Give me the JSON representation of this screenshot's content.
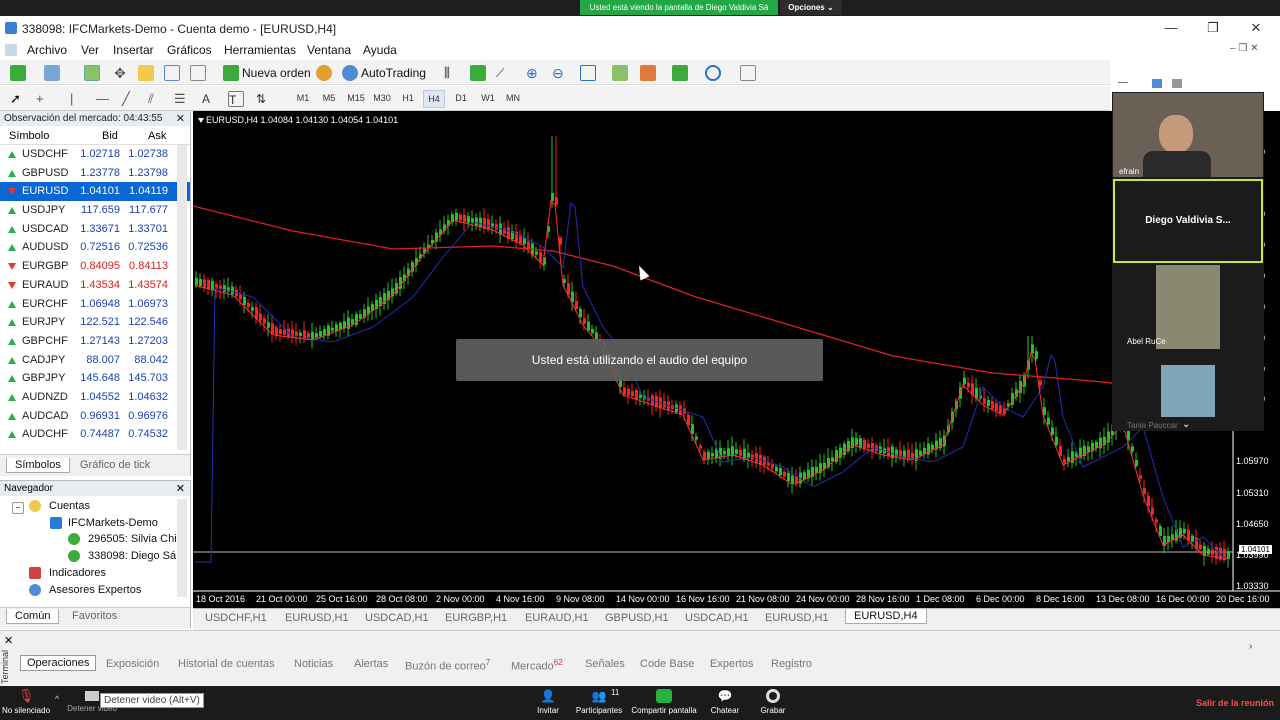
{
  "zoom_top": {
    "sharing_text": "Usted está viendo la pantalla de Diego Valdivia Sá",
    "options_label": "Opciones"
  },
  "window": {
    "title": "338098: IFCMarkets-Demo - Cuenta demo - [EURUSD,H4]"
  },
  "menu": [
    "Archivo",
    "Ver",
    "Insertar",
    "Gráficos",
    "Herramientas",
    "Ventana",
    "Ayuda"
  ],
  "toolbar": {
    "new_order": "Nueva orden",
    "autotrading": "AutoTrading",
    "timeframes": [
      "M1",
      "M5",
      "M15",
      "M30",
      "H1",
      "H4",
      "D1",
      "W1",
      "MN"
    ],
    "active_timeframe": "H4"
  },
  "market_watch": {
    "title": "Observación del mercado: 04:43:55",
    "columns": {
      "symbol": "Símbolo",
      "bid": "Bid",
      "ask": "Ask"
    },
    "rows": [
      {
        "symbol": "USDCHF",
        "bid": "1.02718",
        "ask": "1.02738",
        "dir": "up"
      },
      {
        "symbol": "GBPUSD",
        "bid": "1.23778",
        "ask": "1.23798",
        "dir": "up"
      },
      {
        "symbol": "EURUSD",
        "bid": "1.04101",
        "ask": "1.04119",
        "dir": "down",
        "selected": true
      },
      {
        "symbol": "USDJPY",
        "bid": "117.659",
        "ask": "117.677",
        "dir": "up"
      },
      {
        "symbol": "USDCAD",
        "bid": "1.33671",
        "ask": "1.33701",
        "dir": "up"
      },
      {
        "symbol": "AUDUSD",
        "bid": "0.72516",
        "ask": "0.72536",
        "dir": "up"
      },
      {
        "symbol": "EURGBP",
        "bid": "0.84095",
        "ask": "0.84113",
        "dir": "down",
        "red": true
      },
      {
        "symbol": "EURAUD",
        "bid": "1.43534",
        "ask": "1.43574",
        "dir": "down",
        "red": true
      },
      {
        "symbol": "EURCHF",
        "bid": "1.06948",
        "ask": "1.06973",
        "dir": "up"
      },
      {
        "symbol": "EURJPY",
        "bid": "122.521",
        "ask": "122.546",
        "dir": "up"
      },
      {
        "symbol": "GBPCHF",
        "bid": "1.27143",
        "ask": "1.27203",
        "dir": "up"
      },
      {
        "symbol": "CADJPY",
        "bid": "88.007",
        "ask": "88.042",
        "dir": "up"
      },
      {
        "symbol": "GBPJPY",
        "bid": "145.648",
        "ask": "145.703",
        "dir": "up"
      },
      {
        "symbol": "AUDNZD",
        "bid": "1.04552",
        "ask": "1.04632",
        "dir": "up"
      },
      {
        "symbol": "AUDCAD",
        "bid": "0.96931",
        "ask": "0.96976",
        "dir": "up"
      },
      {
        "symbol": "AUDCHF",
        "bid": "0.74487",
        "ask": "0.74532",
        "dir": "up"
      }
    ],
    "tabs": [
      "Símbolos",
      "Gráfico de tick"
    ]
  },
  "navigator": {
    "title": "Navegador",
    "accounts": "Cuentas",
    "server": "IFCMarkets-Demo",
    "account1": "296505: Silvia Chi",
    "account2": "338098: Diego Sá",
    "indicators": "Indicadores",
    "experts": "Asesores Expertos",
    "tabs": [
      "Común",
      "Favoritos"
    ]
  },
  "chart": {
    "header": "EURUSD,H4  1.04084 1.04130 1.04054 1.04101",
    "price_tag": "1.04101",
    "audio_notice": "Usted está utilizando el audio del equipo",
    "y_ticks": [
      "10",
      "90",
      "80",
      "70",
      "60",
      "50",
      "40",
      "30",
      "1.05970",
      "1.05310",
      "1.04650",
      "1.03990",
      "1.03330"
    ],
    "x_ticks": [
      "18 Oct 2016",
      "21 Oct 00:00",
      "25 Oct 16:00",
      "28 Oct 08:00",
      "2 Nov 00:00",
      "4 Nov 16:00",
      "9 Nov 08:00",
      "14 Nov 00:00",
      "16 Nov 16:00",
      "21 Nov 08:00",
      "24 Nov 00:00",
      "28 Nov 16:00",
      "1 Dec 08:00",
      "6 Dec 00:00",
      "8 Dec 16:00",
      "13 Dec 08:00",
      "16 Dec 00:00",
      "20 Dec 16:00"
    ],
    "colors": {
      "bull": "#22c522",
      "bear": "#ff2020",
      "ma_slow": "#e02020",
      "ma_fast": "#ff3030",
      "ma_blue": "#2030b0"
    }
  },
  "chart_tabs": [
    "USDCHF,H1",
    "EURUSD,H1",
    "USDCAD,H1",
    "EURGBP,H1",
    "EURAUD,H1",
    "GBPUSD,H1",
    "USDCAD,H1",
    "EURUSD,H1",
    "EURUSD,H4"
  ],
  "terminal": {
    "side_label": "Terminal",
    "tabs": [
      "Operaciones",
      "Exposición",
      "Historial de cuentas",
      "Noticias",
      "Alertas",
      "Buzón de correo",
      "Mercado",
      "Señales",
      "Code Base",
      "Expertos",
      "Registro"
    ],
    "mail_badge": "7",
    "market_badge": "62"
  },
  "zoom_bottom": {
    "mute": "No silenciado",
    "video": "Detener video",
    "video_tooltip": "Detener video (Alt+V)",
    "invite": "Invitar",
    "participants": "Participantes",
    "participants_count": "11",
    "share": "Compartir pantalla",
    "chat": "Chatear",
    "record": "Grabar",
    "leave": "Salir de la reunión"
  },
  "participants_panel": {
    "p1": "efrain",
    "p2": "Diego  Valdivia  S...",
    "p3": "Abel RuCe",
    "p4": "Tania Pauccar"
  }
}
